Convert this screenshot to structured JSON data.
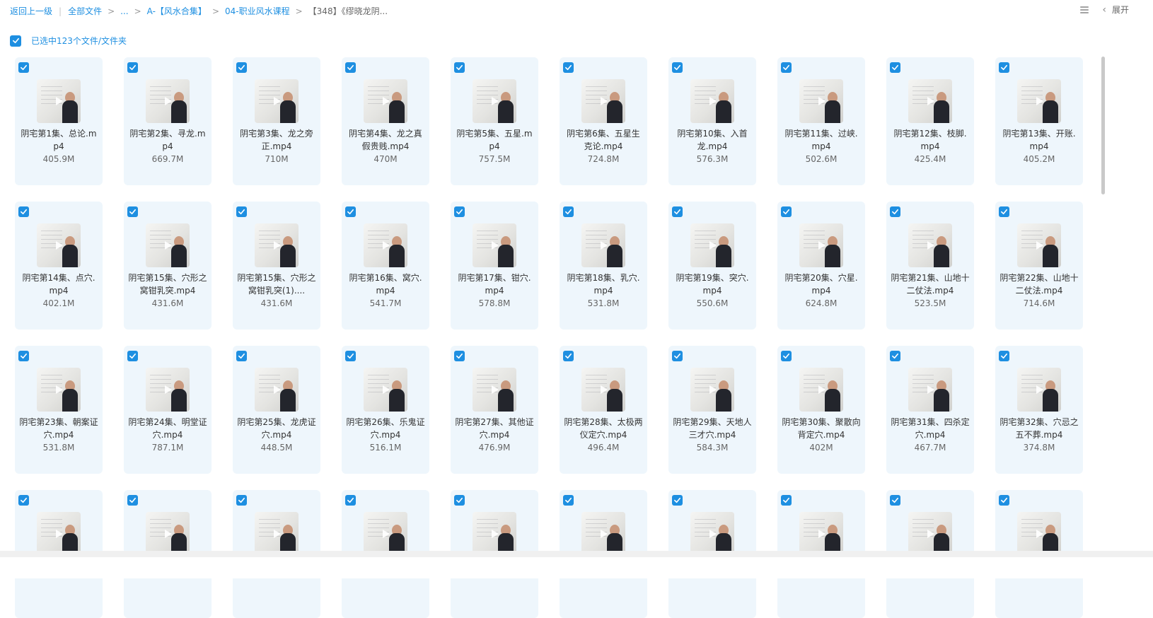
{
  "breadcrumb": {
    "back": "返回上一级",
    "all_files": "全部文件",
    "ellipsis": "...",
    "level1": "A-【风水合集】",
    "level2": "04-职业风水课程",
    "current": "【348】《缪晓龙阴..."
  },
  "toolbar": {
    "expand_label": "展开"
  },
  "selection": {
    "label": "已选中123个文件/文件夹"
  },
  "colors": {
    "accent": "#1e8fe1",
    "card_bg": "#eef6fc"
  },
  "files": [
    {
      "name": "阴宅第1集、总论.mp4",
      "size": "405.9M"
    },
    {
      "name": "阴宅第2集、寻龙.mp4",
      "size": "669.7M"
    },
    {
      "name": "阴宅第3集、龙之旁正.mp4",
      "size": "710M"
    },
    {
      "name": "阴宅第4集、龙之真假贵贱.mp4",
      "size": "470M"
    },
    {
      "name": "阴宅第5集、五星.mp4",
      "size": "757.5M"
    },
    {
      "name": "阴宅第6集、五星生克论.mp4",
      "size": "724.8M"
    },
    {
      "name": "阴宅第10集、入首龙.mp4",
      "size": "576.3M"
    },
    {
      "name": "阴宅第11集、过峡.mp4",
      "size": "502.6M"
    },
    {
      "name": "阴宅第12集、枝脚.mp4",
      "size": "425.4M"
    },
    {
      "name": "阴宅第13集、开账.mp4",
      "size": "405.2M"
    },
    {
      "name": "阴宅第14集、点穴.mp4",
      "size": "402.1M"
    },
    {
      "name": "阴宅第15集、穴形之窝钳乳突.mp4",
      "size": "431.6M"
    },
    {
      "name": "阴宅第15集、穴形之窝钳乳突(1)....",
      "size": "431.6M"
    },
    {
      "name": "阴宅第16集、窝穴.mp4",
      "size": "541.7M"
    },
    {
      "name": "阴宅第17集、钳穴.mp4",
      "size": "578.8M"
    },
    {
      "name": "阴宅第18集、乳穴.mp4",
      "size": "531.8M"
    },
    {
      "name": "阴宅第19集、突穴.mp4",
      "size": "550.6M"
    },
    {
      "name": "阴宅第20集、穴星.mp4",
      "size": "624.8M"
    },
    {
      "name": "阴宅第21集、山地十二仗法.mp4",
      "size": "523.5M"
    },
    {
      "name": "阴宅第22集、山地十二仗法.mp4",
      "size": "714.6M"
    },
    {
      "name": "阴宅第23集、朝案证穴.mp4",
      "size": "531.8M"
    },
    {
      "name": "阴宅第24集、明堂证穴.mp4",
      "size": "787.1M"
    },
    {
      "name": "阴宅第25集、龙虎证穴.mp4",
      "size": "448.5M"
    },
    {
      "name": "阴宅第26集、乐鬼证穴.mp4",
      "size": "516.1M"
    },
    {
      "name": "阴宅第27集、其他证穴.mp4",
      "size": "476.9M"
    },
    {
      "name": "阴宅第28集、太极两仪定穴.mp4",
      "size": "496.4M"
    },
    {
      "name": "阴宅第29集、天地人三才穴.mp4",
      "size": "584.3M"
    },
    {
      "name": "阴宅第30集、聚散向背定穴.mp4",
      "size": "402M"
    },
    {
      "name": "阴宅第31集、四杀定穴.mp4",
      "size": "467.7M"
    },
    {
      "name": "阴宅第32集、穴忌之五不葬.mp4",
      "size": "374.8M"
    },
    {
      "name": "",
      "size": ""
    },
    {
      "name": "",
      "size": ""
    },
    {
      "name": "",
      "size": ""
    },
    {
      "name": "",
      "size": ""
    },
    {
      "name": "",
      "size": ""
    },
    {
      "name": "",
      "size": ""
    },
    {
      "name": "",
      "size": ""
    },
    {
      "name": "",
      "size": ""
    },
    {
      "name": "",
      "size": ""
    },
    {
      "name": "",
      "size": ""
    }
  ]
}
